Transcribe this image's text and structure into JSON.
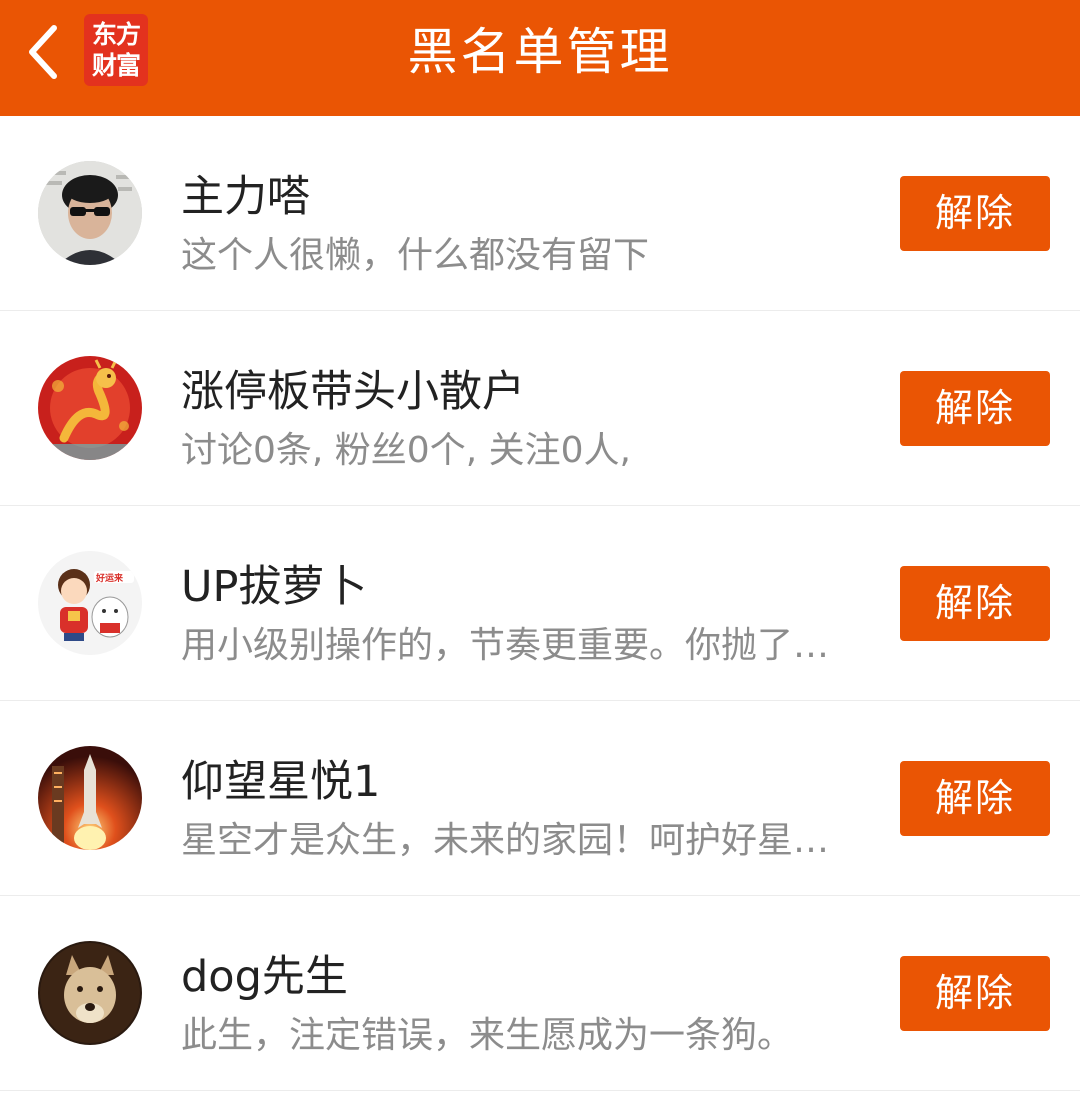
{
  "header": {
    "title": "黑名单管理",
    "back_icon": "chevron-left-icon",
    "logo_line1": "东方",
    "logo_line2": "财富",
    "bg_color": "#EA5504"
  },
  "list": {
    "items": [
      {
        "name": "主力嗒",
        "desc": "这个人很懒，什么都没有留下",
        "button": "解除"
      },
      {
        "name": "涨停板带头小散户",
        "desc": "讨论0条, 粉丝0个, 关注0人,",
        "button": "解除"
      },
      {
        "name": "UP拔萝卜",
        "desc": "用小级别操作的，节奏更重要。你抛了…",
        "button": "解除"
      },
      {
        "name": "仰望星悦1",
        "desc": "星空才是众生，未来的家园！呵护好星…",
        "button": "解除"
      },
      {
        "name": "dog先生",
        "desc": "此生，注定错误，来生愿成为一条狗。",
        "button": "解除"
      }
    ]
  }
}
